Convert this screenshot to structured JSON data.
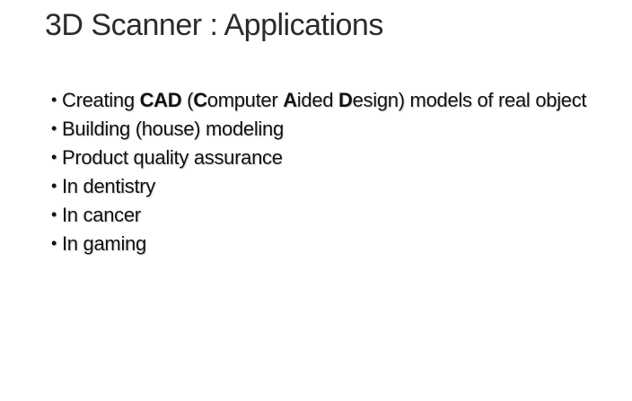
{
  "slide": {
    "title": "3D Scanner : Applications",
    "bullet_glyph": "•",
    "bullets": [
      {
        "parts": [
          {
            "text": "Creating ",
            "bold": false
          },
          {
            "text": "CAD",
            "bold": true
          },
          {
            "text": " (",
            "bold": false
          },
          {
            "text": "C",
            "bold": true
          },
          {
            "text": "omputer ",
            "bold": false
          },
          {
            "text": "A",
            "bold": true
          },
          {
            "text": "ided ",
            "bold": false
          },
          {
            "text": "D",
            "bold": true
          },
          {
            "text": "esign) models of real object",
            "bold": false
          }
        ]
      },
      {
        "parts": [
          {
            "text": "Building (house) modeling",
            "bold": false
          }
        ]
      },
      {
        "parts": [
          {
            "text": "Product quality assurance",
            "bold": false
          }
        ]
      },
      {
        "parts": [
          {
            "text": "In dentistry",
            "bold": false
          }
        ]
      },
      {
        "parts": [
          {
            "text": "In cancer",
            "bold": false
          }
        ]
      },
      {
        "parts": [
          {
            "text": "In gaming",
            "bold": false
          }
        ]
      }
    ]
  }
}
